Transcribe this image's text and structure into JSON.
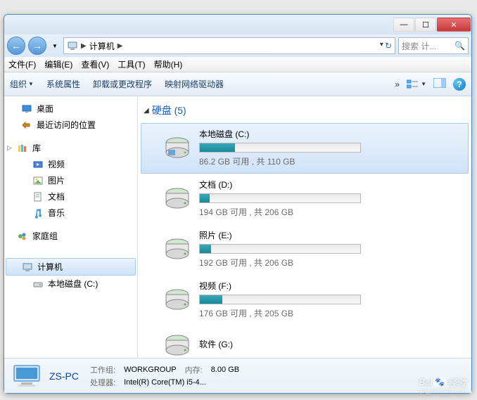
{
  "breadcrumb": {
    "text": "计算机",
    "arrow": "▶"
  },
  "search": {
    "placeholder": "搜索 计..."
  },
  "menu": {
    "file": "文件(F)",
    "edit": "编辑(E)",
    "view": "查看(V)",
    "tools": "工具(T)",
    "help": "帮助(H)"
  },
  "toolbar": {
    "organize": "组织",
    "props": "系统属性",
    "uninstall": "卸载或更改程序",
    "network": "映射网络驱动器"
  },
  "sidebar": {
    "desktop": "桌面",
    "recent": "最近访问的位置",
    "libraries": "库",
    "videos": "视频",
    "pictures": "图片",
    "documents": "文档",
    "music": "音乐",
    "homegroup": "家庭组",
    "computer": "计算机",
    "cdrive": "本地磁盘 (C:)"
  },
  "main": {
    "group_label": "硬盘 (5)",
    "drives": [
      {
        "name": "本地磁盘 (C:)",
        "stat": "86.2 GB 可用 , 共 110 GB",
        "fill": 22,
        "sel": true
      },
      {
        "name": "文档 (D:)",
        "stat": "194 GB 可用 , 共 206 GB",
        "fill": 6,
        "sel": false
      },
      {
        "name": "照片 (E:)",
        "stat": "192 GB 可用 , 共 206 GB",
        "fill": 7,
        "sel": false
      },
      {
        "name": "视频 (F:)",
        "stat": "176 GB 可用 , 共 205 GB",
        "fill": 14,
        "sel": false
      },
      {
        "name": "软件 (G:)",
        "stat": "",
        "fill": 0,
        "sel": false
      }
    ]
  },
  "status": {
    "pc": "ZS-PC",
    "wg_label": "工作组:",
    "wg_value": "WORKGROUP",
    "mem_label": "内存:",
    "mem_value": "8.00 GB",
    "cpu_label": "处理器:",
    "cpu_value": "Intel(R) Core(TM) i5-4..."
  },
  "watermark": {
    "brand1": "Bai",
    "brand2": "经验",
    "sub": "jingyan.baidu.com"
  }
}
